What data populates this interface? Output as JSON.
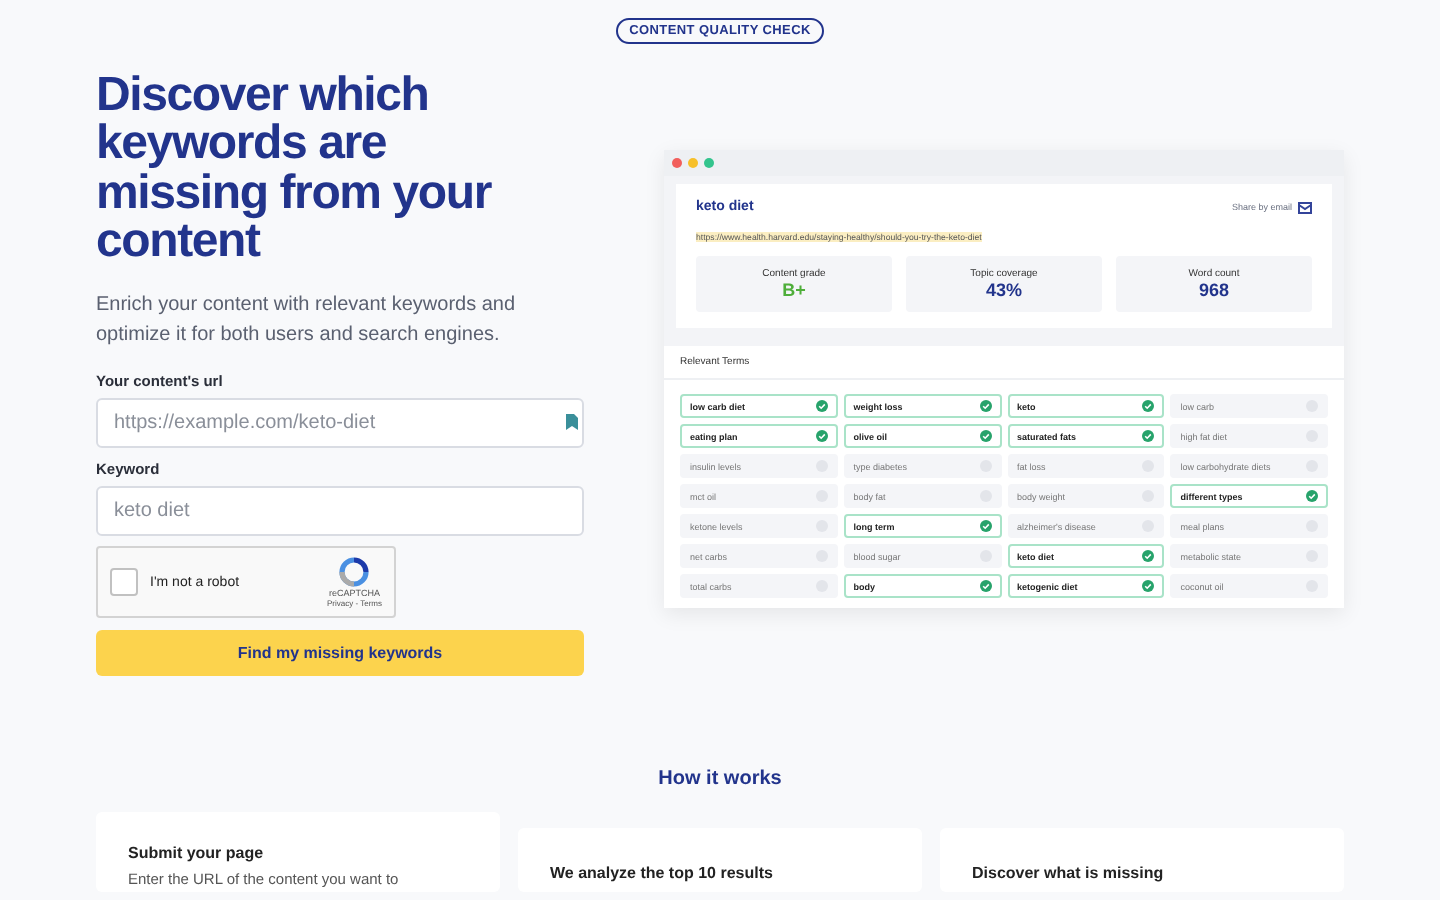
{
  "badge": "CONTENT QUALITY CHECK",
  "hero": {
    "title": "Discover which keywords are missing from your content",
    "subtitle": "Enrich your content with relevant keywords and optimize it for both users and search engines."
  },
  "form": {
    "url_label": "Your content's url",
    "url_placeholder": "https://example.com/keto-diet",
    "keyword_label": "Keyword",
    "keyword_placeholder": "keto diet",
    "captcha": {
      "label": "I'm not a robot",
      "checked": false,
      "brand": "reCAPTCHA",
      "links": "Privacy - Terms"
    },
    "submit": "Find my missing keywords"
  },
  "preview": {
    "keyword": "keto diet",
    "url": "https://www.health.harvard.edu/staying-healthy/should-you-try-the-keto-diet",
    "share": "Share by email",
    "stats": [
      {
        "label": "Content grade",
        "value": "B+",
        "kind": "grade"
      },
      {
        "label": "Topic coverage",
        "value": "43%",
        "kind": "number"
      },
      {
        "label": "Word count",
        "value": "968",
        "kind": "number"
      }
    ],
    "terms_title": "Relevant Terms",
    "terms": [
      {
        "label": "low carb diet",
        "checked": true
      },
      {
        "label": "weight loss",
        "checked": true
      },
      {
        "label": "keto",
        "checked": true
      },
      {
        "label": "low carb",
        "checked": false
      },
      {
        "label": "eating plan",
        "checked": true
      },
      {
        "label": "olive oil",
        "checked": true
      },
      {
        "label": "saturated fats",
        "checked": true
      },
      {
        "label": "high fat diet",
        "checked": false
      },
      {
        "label": "insulin levels",
        "checked": false
      },
      {
        "label": "type diabetes",
        "checked": false
      },
      {
        "label": "fat loss",
        "checked": false
      },
      {
        "label": "low carbohydrate diets",
        "checked": false
      },
      {
        "label": "mct oil",
        "checked": false
      },
      {
        "label": "body fat",
        "checked": false
      },
      {
        "label": "body weight",
        "checked": false
      },
      {
        "label": "different types",
        "checked": true
      },
      {
        "label": "ketone levels",
        "checked": false
      },
      {
        "label": "long term",
        "checked": true
      },
      {
        "label": "alzheimer's disease",
        "checked": false
      },
      {
        "label": "meal plans",
        "checked": false
      },
      {
        "label": "net carbs",
        "checked": false
      },
      {
        "label": "blood sugar",
        "checked": false
      },
      {
        "label": "keto diet",
        "checked": true
      },
      {
        "label": "metabolic state",
        "checked": false
      },
      {
        "label": "total carbs",
        "checked": false
      },
      {
        "label": "body",
        "checked": true
      },
      {
        "label": "ketogenic diet",
        "checked": true
      },
      {
        "label": "coconut oil",
        "checked": false
      }
    ]
  },
  "how": {
    "title": "How it works",
    "steps": [
      {
        "title": "Submit your page",
        "text": "Enter the URL of the content you want to"
      },
      {
        "title": "We analyze the top 10 results"
      },
      {
        "title": "Discover what is missing"
      }
    ]
  }
}
